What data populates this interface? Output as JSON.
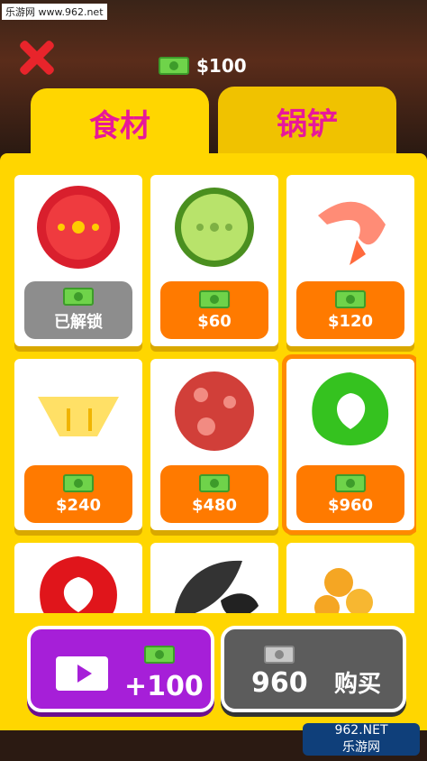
{
  "watermark": {
    "top": "乐游网 www.962.net",
    "bottom_1": "962.NET",
    "bottom_2": "乐游网"
  },
  "balance": "$100",
  "tabs": [
    "食材",
    "锅铲"
  ],
  "items": [
    {
      "name": "tomato",
      "price": "已解锁",
      "state": "unlocked"
    },
    {
      "name": "cucumber",
      "price": "$60",
      "state": "locked"
    },
    {
      "name": "shrimp",
      "price": "$120",
      "state": "locked"
    },
    {
      "name": "pineapple",
      "price": "$240",
      "state": "locked"
    },
    {
      "name": "pepperoni",
      "price": "$480",
      "state": "locked"
    },
    {
      "name": "green-pepper",
      "price": "$960",
      "state": "selected"
    },
    {
      "name": "red-pepper",
      "price": "",
      "state": "partial"
    },
    {
      "name": "mushroom",
      "price": "",
      "state": "partial"
    },
    {
      "name": "corn",
      "price": "",
      "state": "partial"
    }
  ],
  "buttons": {
    "ad_amount": "+100",
    "buy_price": "960",
    "buy_label": "购买"
  },
  "colors": {
    "accent": "#ffd600",
    "tab_text": "#e8189a",
    "price": "#ff7a00",
    "purple": "#a61fd8"
  }
}
